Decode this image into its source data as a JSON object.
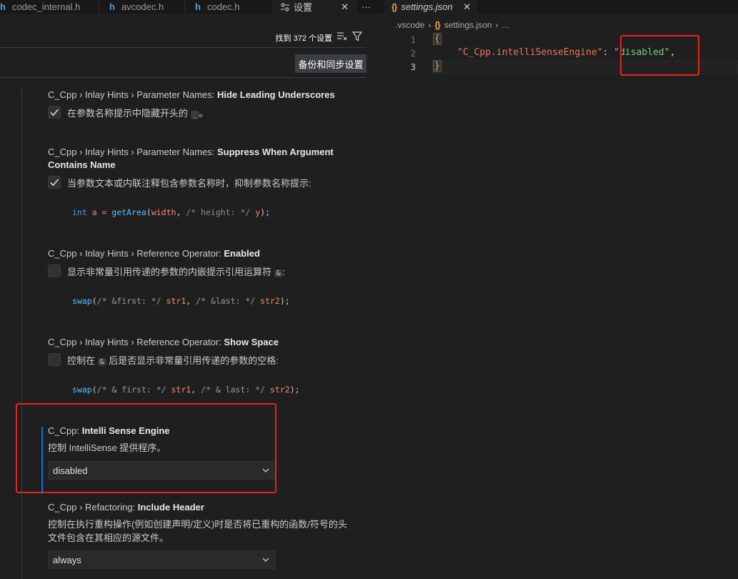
{
  "tabs": [
    {
      "label": "codec_internal.h",
      "icon": "h"
    },
    {
      "label": "avcodec.h",
      "icon": "h"
    },
    {
      "label": "codec.h",
      "icon": "h"
    },
    {
      "label": "设置",
      "icon": "settings-icon"
    },
    {
      "label": "settings.json",
      "icon": "{}"
    }
  ],
  "more_actions": "···",
  "settings": {
    "result_count": "找到 372 个设置",
    "sync_button": "备份和同步设置",
    "items": [
      {
        "prefix": "C_Cpp › Inlay Hints › Parameter Names: ",
        "name": "Hide Leading Underscores",
        "desc_before": "在参数名称提示中隐藏开头的",
        "code_token": "_",
        "desc_after": "。",
        "checked": true
      },
      {
        "prefix": "C_Cpp › Inlay Hints › Parameter Names: ",
        "name": "Suppress When Argument Contains Name",
        "desc": "当参数文本或内联注释包含参数名称时，抑制参数名称提示:",
        "checked": true,
        "example": {
          "kw": "int",
          "var": " a = ",
          "fn": "getArea",
          "open": "(",
          "p1": "width",
          "comma1": ", ",
          "cmt": "/* height: */",
          "sp": " ",
          "p2": "y",
          "close": ");"
        }
      },
      {
        "prefix": "C_Cpp › Inlay Hints › Reference Operator: ",
        "name": "Enabled",
        "desc_before": "显示非常量引用传递的参数的内嵌提示引用运算符",
        "code_token": "&",
        "desc_after": ":",
        "checked": false,
        "example": {
          "fn": "swap",
          "open": "(",
          "cmt1": "/* &first: */",
          "p1": " str1",
          "comma": ", ",
          "cmt2": "/* &last: */",
          "p2": " str2",
          "close": ");"
        }
      },
      {
        "prefix": "C_Cpp › Inlay Hints › Reference Operator: ",
        "name": "Show Space",
        "desc_before": "控制在",
        "code_token": "&",
        "desc_after": "后是否显示非常量引用传递的参数的空格:",
        "checked": false,
        "example": {
          "fn": "swap",
          "open": "(",
          "cmt1": "/* & first: */",
          "p1": " str1",
          "comma": ", ",
          "cmt2": "/* & last: */",
          "p2": " str2",
          "close": ");"
        }
      },
      {
        "prefix": "C_Cpp: ",
        "name": "Intelli Sense Engine",
        "desc": "控制 IntelliSense 提供程序。",
        "value": "disabled"
      },
      {
        "prefix": "C_Cpp › Refactoring: ",
        "name": "Include Header",
        "desc": "控制在执行重构操作(例如创建声明/定义)时是否将已重构的函数/符号的头文件包含在其相应的源文件。",
        "value": "always"
      }
    ]
  },
  "editor": {
    "breadcrumb": [
      ".vscode",
      "settings.json",
      "..."
    ],
    "line_numbers": [
      "1",
      "2",
      "3"
    ],
    "lines": {
      "open": "{",
      "key": "\"C_Cpp.intelliSenseEngine\"",
      "colon": ": ",
      "value": "\"disabled\"",
      "comma": ",",
      "close": "}"
    }
  },
  "colors": {
    "accent": "#0078d4",
    "highlight_box": "#e8231d",
    "background": "#1f1f1f"
  }
}
